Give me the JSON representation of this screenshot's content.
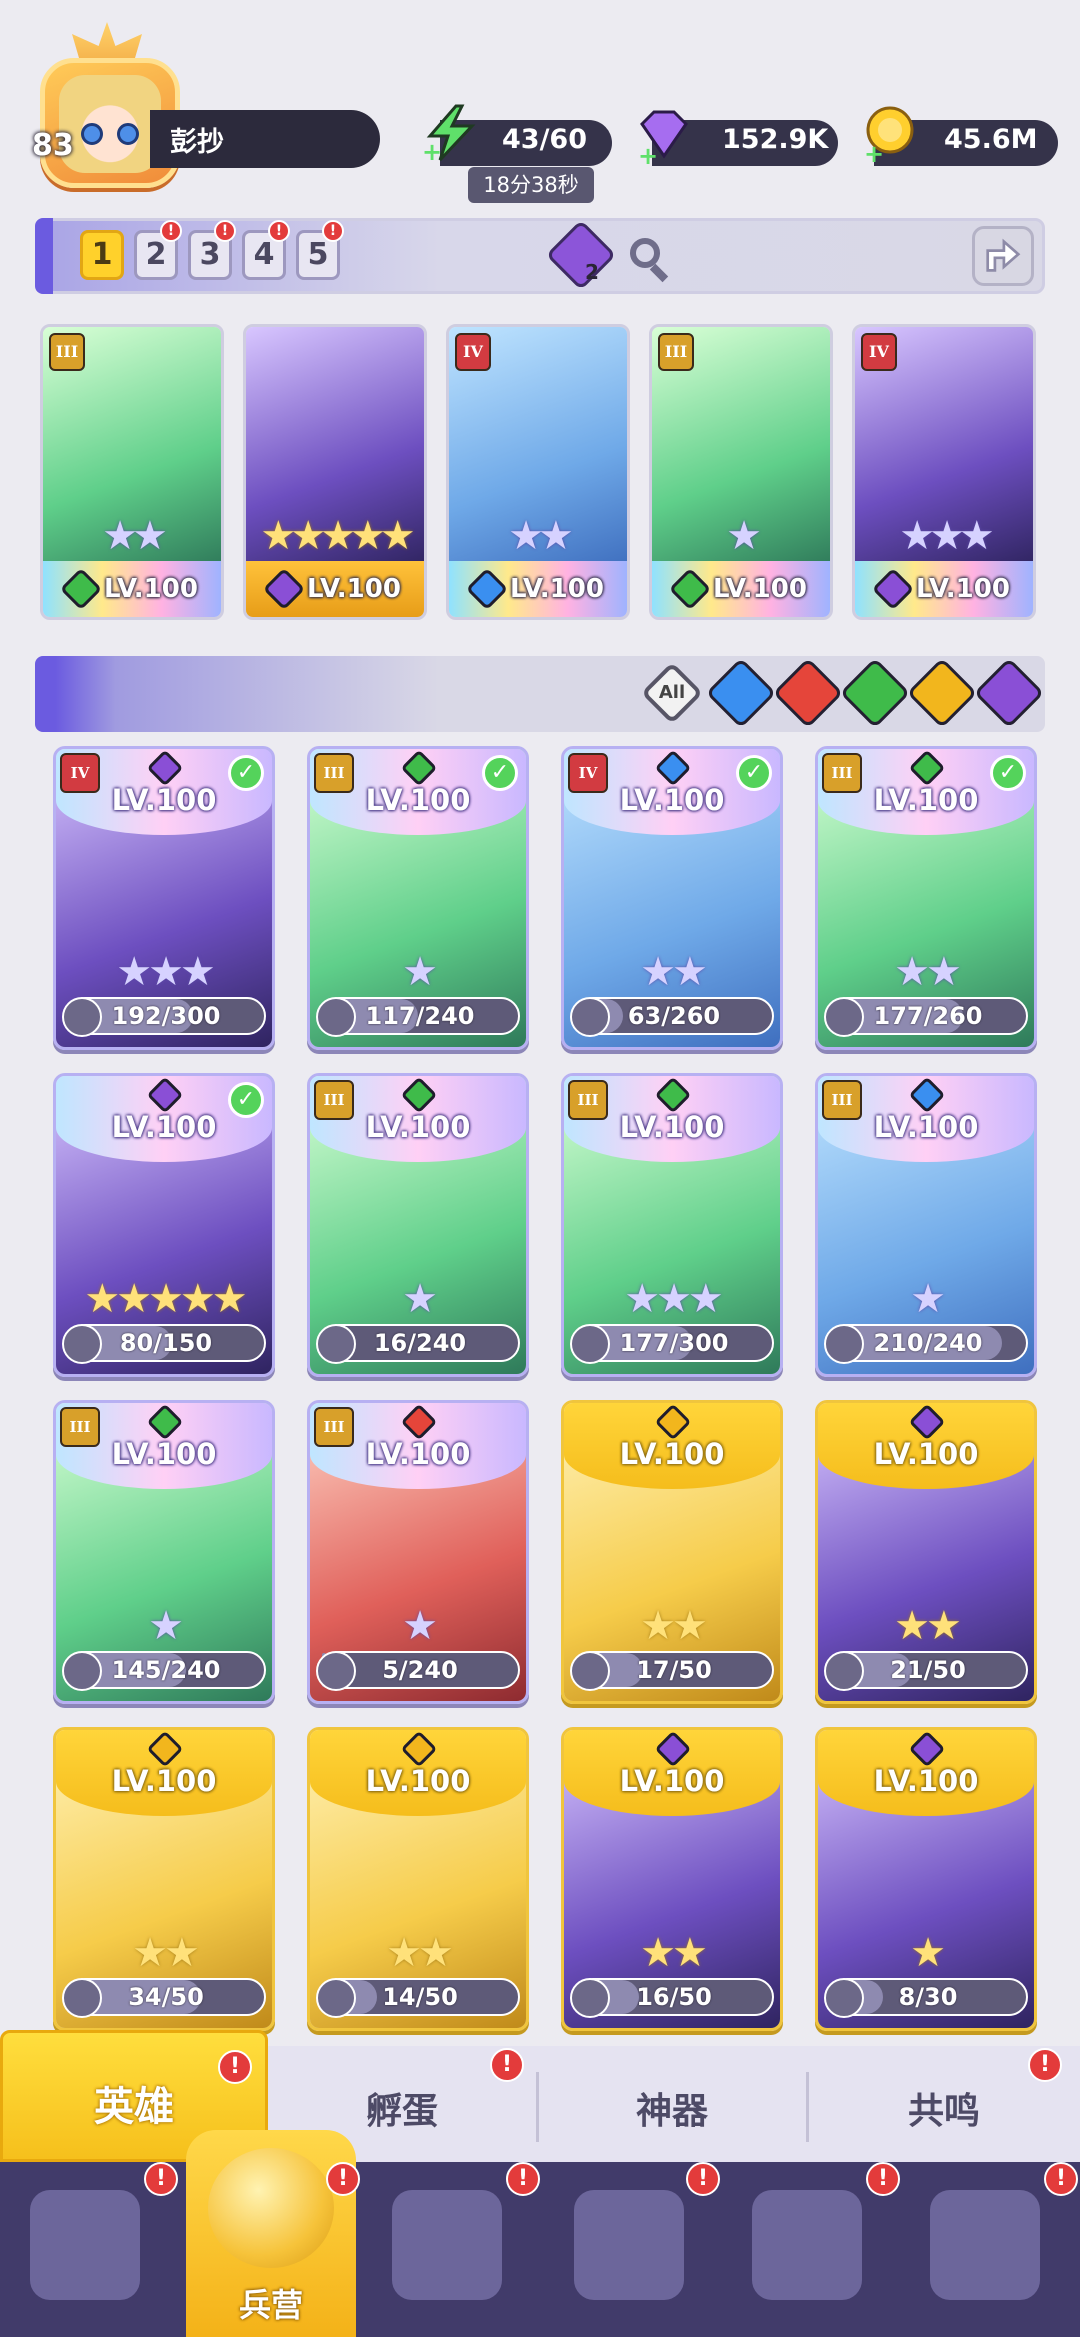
{
  "player": {
    "level": "83",
    "name": "彭抄"
  },
  "resources": {
    "energy": "43/60",
    "energy_timer": "18分38秒",
    "gems": "152.9K",
    "gold": "45.6M"
  },
  "team_tabs": [
    {
      "label": "1",
      "active": true,
      "alert": false
    },
    {
      "label": "2",
      "active": false,
      "alert": true
    },
    {
      "label": "3",
      "active": false,
      "alert": true
    },
    {
      "label": "4",
      "active": false,
      "alert": true
    },
    {
      "label": "5",
      "active": false,
      "alert": true
    }
  ],
  "team_gem_count": "2",
  "team": [
    {
      "level": "LV.100",
      "rank": "III",
      "element": "nature",
      "stars": "★★"
    },
    {
      "level": "LV.100",
      "rank": "",
      "element": "dark",
      "stars": "★★★★★"
    },
    {
      "level": "LV.100",
      "rank": "IV",
      "element": "water",
      "stars": "★★"
    },
    {
      "level": "LV.100",
      "rank": "III",
      "element": "nature",
      "stars": "★"
    },
    {
      "level": "LV.100",
      "rank": "IV",
      "element": "dark",
      "stars": "★★★"
    }
  ],
  "filter": {
    "all_label": "All",
    "elements": [
      "water",
      "fire",
      "nature",
      "light",
      "dark"
    ]
  },
  "heroes": [
    {
      "level": "LV.100",
      "rank": "IV",
      "element": "dark",
      "check": true,
      "stars": "★★★",
      "progress": "192/300",
      "fraction": 0.64
    },
    {
      "level": "LV.100",
      "rank": "III",
      "element": "nature",
      "check": true,
      "stars": "★",
      "progress": "117/240",
      "fraction": 0.49
    },
    {
      "level": "LV.100",
      "rank": "IV",
      "element": "water",
      "check": true,
      "stars": "★★",
      "progress": "63/260",
      "fraction": 0.24
    },
    {
      "level": "LV.100",
      "rank": "III",
      "element": "nature",
      "check": true,
      "stars": "★★",
      "progress": "177/260",
      "fraction": 0.68
    },
    {
      "level": "LV.100",
      "rank": "",
      "element": "dark",
      "check": true,
      "stars": "★★★★★",
      "progress": "80/150",
      "fraction": 0.53
    },
    {
      "level": "LV.100",
      "rank": "III",
      "element": "nature",
      "check": false,
      "stars": "★",
      "progress": "16/240",
      "fraction": 0.07
    },
    {
      "level": "LV.100",
      "rank": "III",
      "element": "nature",
      "check": false,
      "stars": "★★★",
      "progress": "177/300",
      "fraction": 0.59
    },
    {
      "level": "LV.100",
      "rank": "III",
      "element": "water",
      "check": false,
      "stars": "★",
      "progress": "210/240",
      "fraction": 0.88
    },
    {
      "level": "LV.100",
      "rank": "III",
      "element": "nature",
      "check": false,
      "stars": "★",
      "progress": "145/240",
      "fraction": 0.6
    },
    {
      "level": "LV.100",
      "rank": "III",
      "element": "fire",
      "check": false,
      "stars": "★",
      "progress": "5/240",
      "fraction": 0.02
    },
    {
      "level": "LV.100",
      "rank": "",
      "element": "light",
      "check": false,
      "stars": "★★",
      "progress": "17/50",
      "fraction": 0.34,
      "gold": true
    },
    {
      "level": "LV.100",
      "rank": "",
      "element": "dark",
      "check": false,
      "stars": "★★",
      "progress": "21/50",
      "fraction": 0.42,
      "gold": true
    },
    {
      "level": "LV.100",
      "rank": "",
      "element": "light",
      "check": false,
      "stars": "★★",
      "progress": "34/50",
      "fraction": 0.68,
      "gold": true
    },
    {
      "level": "LV.100",
      "rank": "",
      "element": "light",
      "check": false,
      "stars": "★★",
      "progress": "14/50",
      "fraction": 0.28,
      "gold": true
    },
    {
      "level": "LV.100",
      "rank": "",
      "element": "dark",
      "check": false,
      "stars": "★★",
      "progress": "16/50",
      "fraction": 0.32,
      "gold": true
    },
    {
      "level": "LV.100",
      "rank": "",
      "element": "dark",
      "check": false,
      "stars": "★",
      "progress": "8/30",
      "fraction": 0.27,
      "gold": true
    }
  ],
  "sub_tabs": [
    "英雄",
    "孵蛋",
    "神器",
    "共鸣"
  ],
  "nav": {
    "active_label": "兵营"
  },
  "colors": {
    "water": "#3a8ff0",
    "fire": "#e5453a",
    "nature": "#3fbb4a",
    "light": "#f2b61d",
    "dark": "#8a4fd6",
    "accent": "#6b5be0"
  }
}
